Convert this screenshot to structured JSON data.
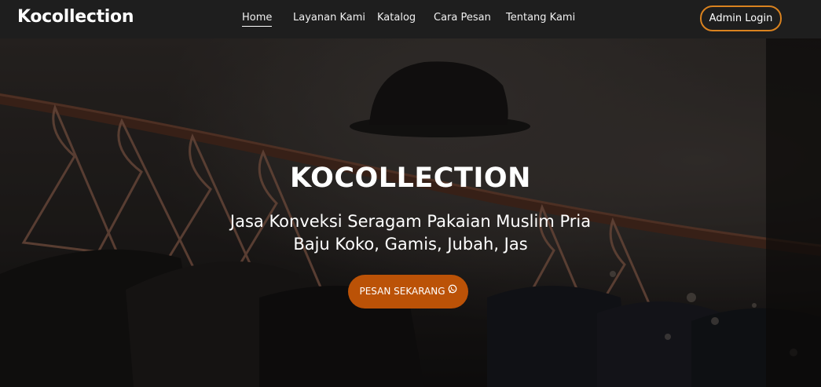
{
  "navbar": {
    "brand": "Kocollection",
    "links": [
      {
        "label": "Home",
        "active": true
      },
      {
        "label": "Layanan Kami",
        "active": false
      },
      {
        "label": "Katalog",
        "active": false
      },
      {
        "label": "Cara Pesan",
        "active": false
      },
      {
        "label": "Tentang Kami",
        "active": false
      }
    ],
    "admin_label": "Admin Login"
  },
  "hero": {
    "title": "KOCOLLECTION",
    "subtitle_line1": "Jasa Konveksi Seragam Pakaian Muslim Pria",
    "subtitle_line2": "Baju Koko, Gamis, Jubah, Jas",
    "cta_label": "PESAN SEKARANG",
    "cta_icon": "whatsapp-icon"
  },
  "colors": {
    "navbar_bg": "#1e1e1e",
    "accent": "#bb5207",
    "admin_border": "#d9821f"
  }
}
